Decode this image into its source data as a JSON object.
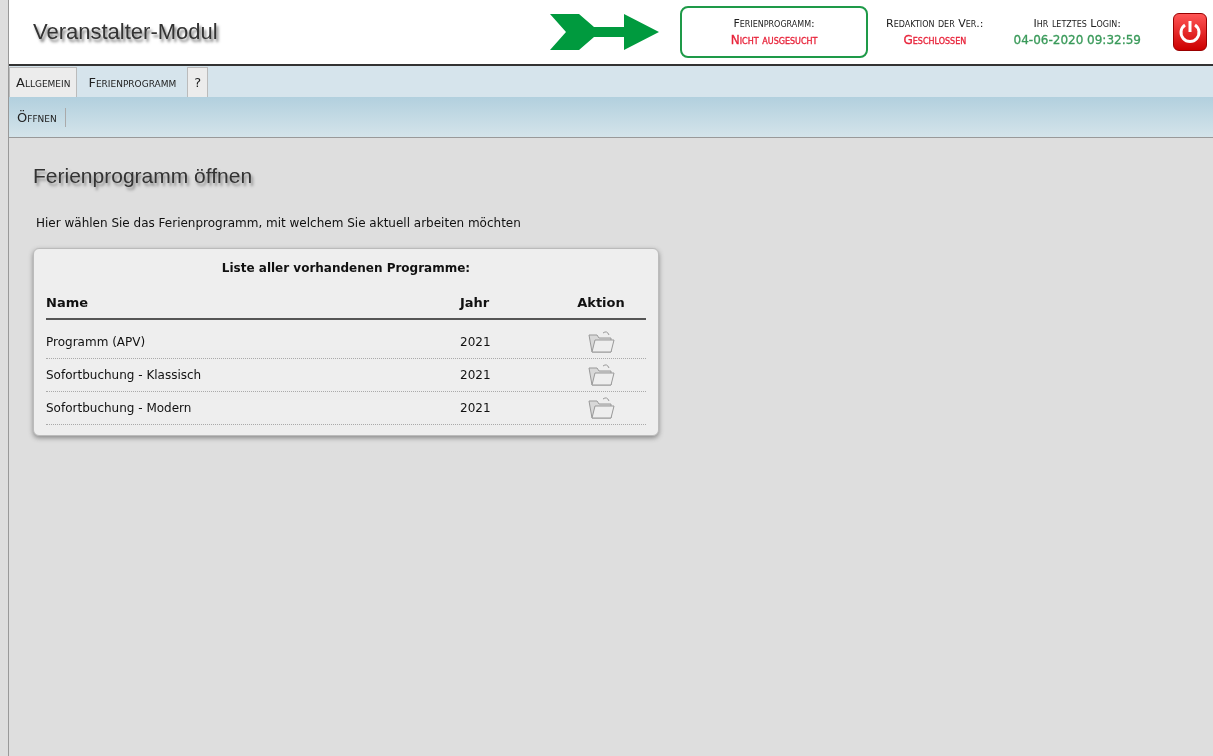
{
  "header": {
    "title": "Veranstalter-Modul",
    "status": [
      {
        "label": "Ferienprogramm:",
        "value": "Nicht ausgesucht",
        "color": "#e8233a",
        "highlighted": true
      },
      {
        "label": "Redaktion der Ver.:",
        "value": "Geschlossen",
        "color": "#e8233a",
        "highlighted": false
      },
      {
        "label": "Ihr letztes Login:",
        "value": "04-06-2020 09:32:59",
        "color": "#3a9a5a",
        "highlighted": false
      }
    ]
  },
  "tabs": [
    {
      "label": "Allgemein",
      "selected": false
    },
    {
      "label": "Ferienprogramm",
      "selected": true
    },
    {
      "label": "?",
      "selected": false
    }
  ],
  "toolbar": [
    "Öffnen"
  ],
  "page": {
    "title": "Ferienprogramm öffnen",
    "intro": "Hier wählen Sie das Ferienprogramm, mit welchem Sie aktuell arbeiten möchten",
    "table": {
      "caption": "Liste aller vorhandenen Programme:",
      "columns": [
        "Name",
        "Jahr",
        "Aktion"
      ],
      "rows": [
        {
          "name": "Programm (APV)",
          "year": "2021"
        },
        {
          "name": "Sofortbuchung - Klassisch",
          "year": "2021"
        },
        {
          "name": "Sofortbuchung - Modern",
          "year": "2021"
        }
      ]
    }
  }
}
